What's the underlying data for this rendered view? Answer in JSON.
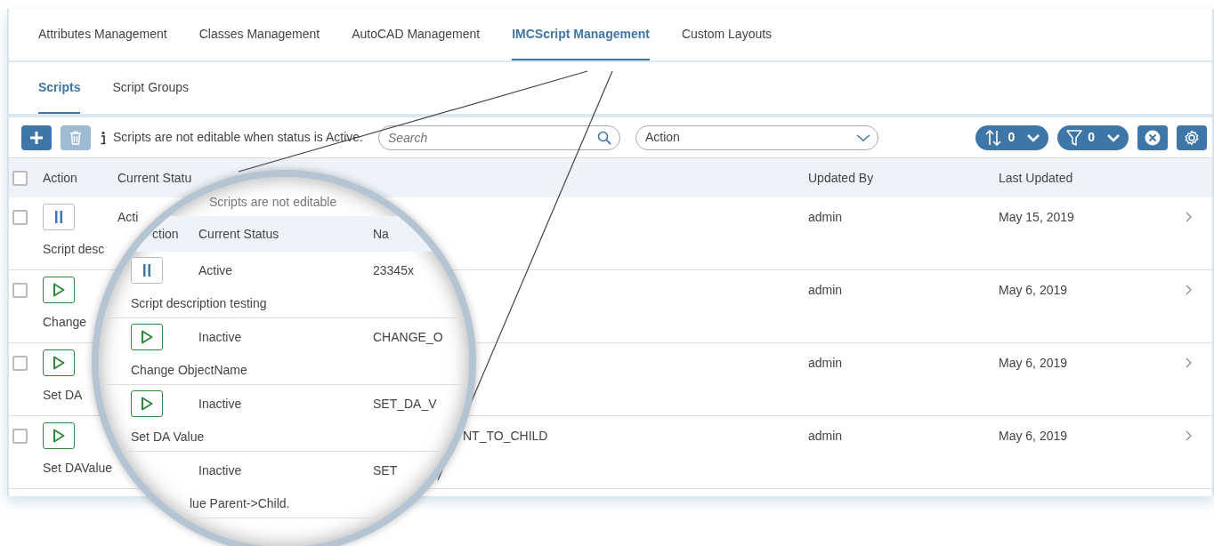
{
  "tabs": [
    {
      "label": "Attributes Management",
      "selected": false
    },
    {
      "label": "Classes Management",
      "selected": false
    },
    {
      "label": "AutoCAD Management",
      "selected": false
    },
    {
      "label": "IMCScript Management",
      "selected": true
    },
    {
      "label": "Custom Layouts",
      "selected": false
    }
  ],
  "subtabs": [
    {
      "label": "Scripts",
      "selected": true
    },
    {
      "label": "Script Groups",
      "selected": false
    }
  ],
  "toolbar": {
    "notice": "Scripts are not editable when status is Active.",
    "search": {
      "placeholder": "Search"
    },
    "dropdown": {
      "value": "Action"
    },
    "sort_count": "0",
    "filter_count": "0"
  },
  "table": {
    "select_all_checked": false,
    "columns": [
      "Action",
      "Current Statu",
      "Updated By",
      "Last Updated"
    ],
    "rows": [
      {
        "kind": "pause",
        "checked": false,
        "status": "Acti",
        "description": "Script desc",
        "updated_by": "admin",
        "last_updated": "May 15, 2019"
      },
      {
        "kind": "play",
        "checked": false,
        "description": "Change",
        "updated_by": "admin",
        "last_updated": "May 6, 2019"
      },
      {
        "kind": "play",
        "checked": false,
        "description": "Set DA",
        "updated_by": "admin",
        "last_updated": "May 6, 2019"
      },
      {
        "kind": "play",
        "checked": false,
        "description": "Set DAValue",
        "name": "NT_TO_CHILD",
        "updated_by": "admin",
        "last_updated": "May 6, 2019"
      }
    ]
  },
  "magnifier": {
    "notice": "Scripts are not editable",
    "columns": [
      "ction",
      "Current Status",
      "Na"
    ],
    "rows": [
      {
        "kind": "pause",
        "status": "Active",
        "name": "23345x",
        "description": "Script description testing"
      },
      {
        "kind": "play",
        "status": "Inactive",
        "name": "CHANGE_O",
        "description": "Change ObjectName"
      },
      {
        "kind": "play",
        "status": "Inactive",
        "name": "SET_DA_V",
        "description": "Set DA Value"
      },
      {
        "kind": "clipped",
        "status": "Inactive",
        "name": "SET",
        "description": "lue Parent->Child."
      }
    ]
  }
}
